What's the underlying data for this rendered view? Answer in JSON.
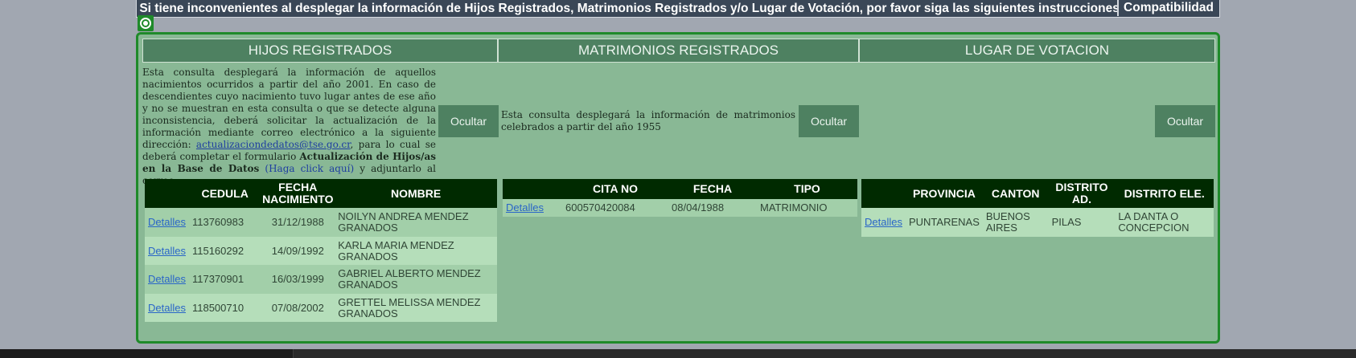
{
  "notice": {
    "text": "Si tiene inconvenientes al desplegar la información de Hijos Registrados, Matrimonios Registrados y/o Lugar de Votación, por favor siga las siguientes instrucciones:",
    "compat_label": "Compatibilidad"
  },
  "hijos": {
    "title": "HIJOS REGISTRADOS",
    "desc_1": "Esta consulta desplegará la información de aquellos nacimientos ocurridos a partir del año 2001. En caso de descendientes cuyo nacimiento tuvo lugar antes de ese año y no se muestran en esta consulta o que se detecte alguna inconsistencia, deberá solicitar la actualización de la información mediante correo electrónico a la siguiente dirección: ",
    "email": "actualizaciondedatos@tse.go.cr",
    "desc_2": ", para lo cual se deberá completar el formulario ",
    "form_name": "Actualización de Hijos/as en la Base de Datos",
    "link_text": " (Haga click aquí)",
    "desc_3": " y adjuntarlo al correo",
    "ocultar": "Ocultar",
    "columns": [
      "",
      "CEDULA",
      "FECHA NACIMIENTO",
      "NOMBRE"
    ],
    "rows": [
      {
        "link": "Detalles",
        "cedula": "113760983",
        "fecha": "31/12/1988",
        "nombre": "NOILYN ANDREA MENDEZ GRANADOS"
      },
      {
        "link": "Detalles",
        "cedula": "115160292",
        "fecha": "14/09/1992",
        "nombre": "KARLA MARIA MENDEZ GRANADOS"
      },
      {
        "link": "Detalles",
        "cedula": "117370901",
        "fecha": "16/03/1999",
        "nombre": "GABRIEL ALBERTO MENDEZ GRANADOS"
      },
      {
        "link": "Detalles",
        "cedula": "118500710",
        "fecha": "07/08/2002",
        "nombre": "GRETTEL MELISSA MENDEZ GRANADOS"
      }
    ]
  },
  "matrimonios": {
    "title": "MATRIMONIOS REGISTRADOS",
    "desc": "Esta consulta desplegará la información de matrimonios celebrados a partir del año 1955",
    "ocultar": "Ocultar",
    "columns": [
      "",
      "CITA NO",
      "FECHA",
      "TIPO"
    ],
    "rows": [
      {
        "link": "Detalles",
        "cita": "600570420084",
        "fecha": "08/04/1988",
        "tipo": "MATRIMONIO"
      }
    ]
  },
  "votacion": {
    "title": "LUGAR DE VOTACION",
    "ocultar": "Ocultar",
    "columns": [
      "",
      "PROVINCIA",
      "CANTON",
      "DISTRITO AD.",
      "DISTRITO ELE."
    ],
    "rows": [
      {
        "link": "Detalles",
        "provincia": "PUNTARENAS",
        "canton": "BUENOS AIRES",
        "distrito_ad": "PILAS",
        "distrito_ele": "LA DANTA O CONCEPCION"
      }
    ]
  },
  "colors": {
    "panel_bg": "#89b895",
    "header_bg": "#4e8161",
    "table_header_bg": "#002a00",
    "frame_green": "#1f8a2a",
    "topbar_bg": "#3a4757"
  }
}
